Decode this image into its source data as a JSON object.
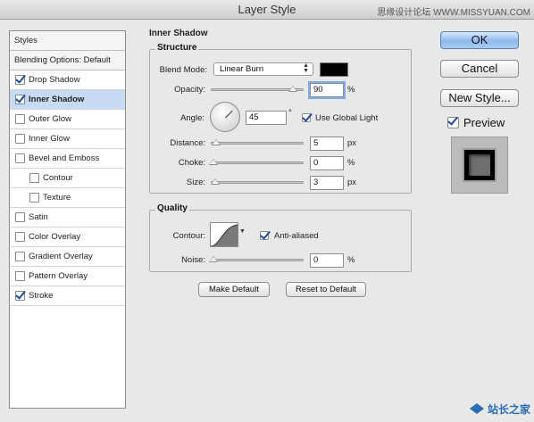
{
  "window": {
    "title": "Layer Style",
    "watermark": "思缘设计论坛 WWW.MISSYUAN.COM"
  },
  "styles_panel": {
    "header": "Styles",
    "blending": "Blending Options: Default",
    "items": [
      {
        "label": "Drop Shadow",
        "checked": true,
        "selected": false,
        "indent": false
      },
      {
        "label": "Inner Shadow",
        "checked": true,
        "selected": true,
        "indent": false
      },
      {
        "label": "Outer Glow",
        "checked": false,
        "selected": false,
        "indent": false
      },
      {
        "label": "Inner Glow",
        "checked": false,
        "selected": false,
        "indent": false
      },
      {
        "label": "Bevel and Emboss",
        "checked": false,
        "selected": false,
        "indent": false
      },
      {
        "label": "Contour",
        "checked": false,
        "selected": false,
        "indent": true
      },
      {
        "label": "Texture",
        "checked": false,
        "selected": false,
        "indent": true
      },
      {
        "label": "Satin",
        "checked": false,
        "selected": false,
        "indent": false
      },
      {
        "label": "Color Overlay",
        "checked": false,
        "selected": false,
        "indent": false
      },
      {
        "label": "Gradient Overlay",
        "checked": false,
        "selected": false,
        "indent": false
      },
      {
        "label": "Pattern Overlay",
        "checked": false,
        "selected": false,
        "indent": false
      },
      {
        "label": "Stroke",
        "checked": true,
        "selected": false,
        "indent": false
      }
    ]
  },
  "inner_shadow": {
    "section_title": "Inner Shadow",
    "structure": {
      "title": "Structure",
      "blend_mode_label": "Blend Mode:",
      "blend_mode_value": "Linear Burn",
      "shadow_color": "#000000",
      "opacity_label": "Opacity:",
      "opacity_value": "90",
      "opacity_unit": "%",
      "angle_label": "Angle:",
      "angle_value": "45",
      "angle_unit": "°",
      "use_global_light_label": "Use Global Light",
      "use_global_light": true,
      "distance_label": "Distance:",
      "distance_value": "5",
      "distance_unit": "px",
      "choke_label": "Choke:",
      "choke_value": "0",
      "choke_unit": "%",
      "size_label": "Size:",
      "size_value": "3",
      "size_unit": "px"
    },
    "quality": {
      "title": "Quality",
      "contour_label": "Contour:",
      "anti_aliased_label": "Anti-aliased",
      "anti_aliased": true,
      "noise_label": "Noise:",
      "noise_value": "0",
      "noise_unit": "%"
    },
    "make_default_label": "Make Default",
    "reset_default_label": "Reset to Default"
  },
  "actions": {
    "ok_label": "OK",
    "cancel_label": "Cancel",
    "new_style_label": "New Style...",
    "preview_label": "Preview",
    "preview_checked": true
  },
  "branding": {
    "logo_text": "站长之家"
  }
}
